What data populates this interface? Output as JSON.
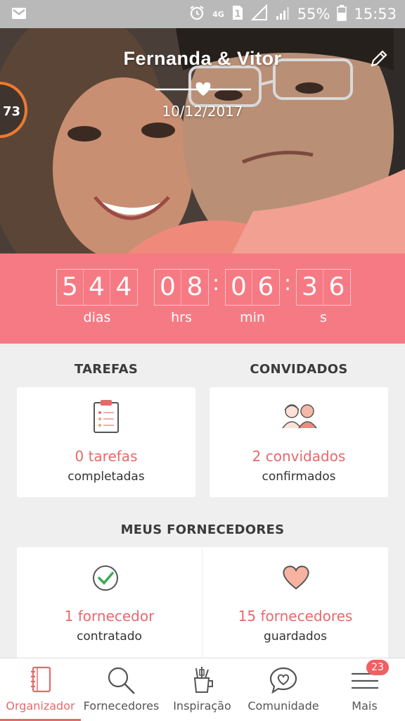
{
  "status_bar": {
    "battery": "55%",
    "time": "15:53",
    "network": "4G",
    "sim": "1"
  },
  "header": {
    "couple_names": "Fernanda & Vitor",
    "date": "10/12/2017",
    "progress_value": "73"
  },
  "countdown": {
    "days_digits": [
      "5",
      "4",
      "4"
    ],
    "hours_digits": [
      "0",
      "8"
    ],
    "minutes_digits": [
      "0",
      "6"
    ],
    "seconds_digits": [
      "3",
      "6"
    ],
    "separator": ":",
    "days_label": "dias",
    "hours_label": "hrs",
    "minutes_label": "min",
    "seconds_label": "s"
  },
  "tasks": {
    "section_title": "TAREFAS",
    "value": "0 tarefas",
    "sub": "completadas"
  },
  "guests": {
    "section_title": "CONVIDADOS",
    "value": "2 convidados",
    "sub": "confirmados"
  },
  "suppliers": {
    "section_title": "MEUS FORNECEDORES",
    "hired_value": "1 fornecedor",
    "hired_sub": "contratado",
    "saved_value": "15 fornecedores",
    "saved_sub": "guardados"
  },
  "bottom_nav": {
    "items": [
      {
        "label": "Organizador",
        "icon": "notebook-icon",
        "active": true
      },
      {
        "label": "Fornecedores",
        "icon": "search-icon",
        "active": false
      },
      {
        "label": "Inspiração",
        "icon": "inspiration-cup-icon",
        "active": false
      },
      {
        "label": "Comunidade",
        "icon": "chat-heart-icon",
        "active": false
      },
      {
        "label": "Mais",
        "icon": "menu-icon",
        "active": false
      }
    ],
    "more_badge": "23"
  },
  "colors": {
    "accent": "#e46a6c",
    "countdown_bg": "#f67a84",
    "status_bar": "#b9b9b9"
  }
}
